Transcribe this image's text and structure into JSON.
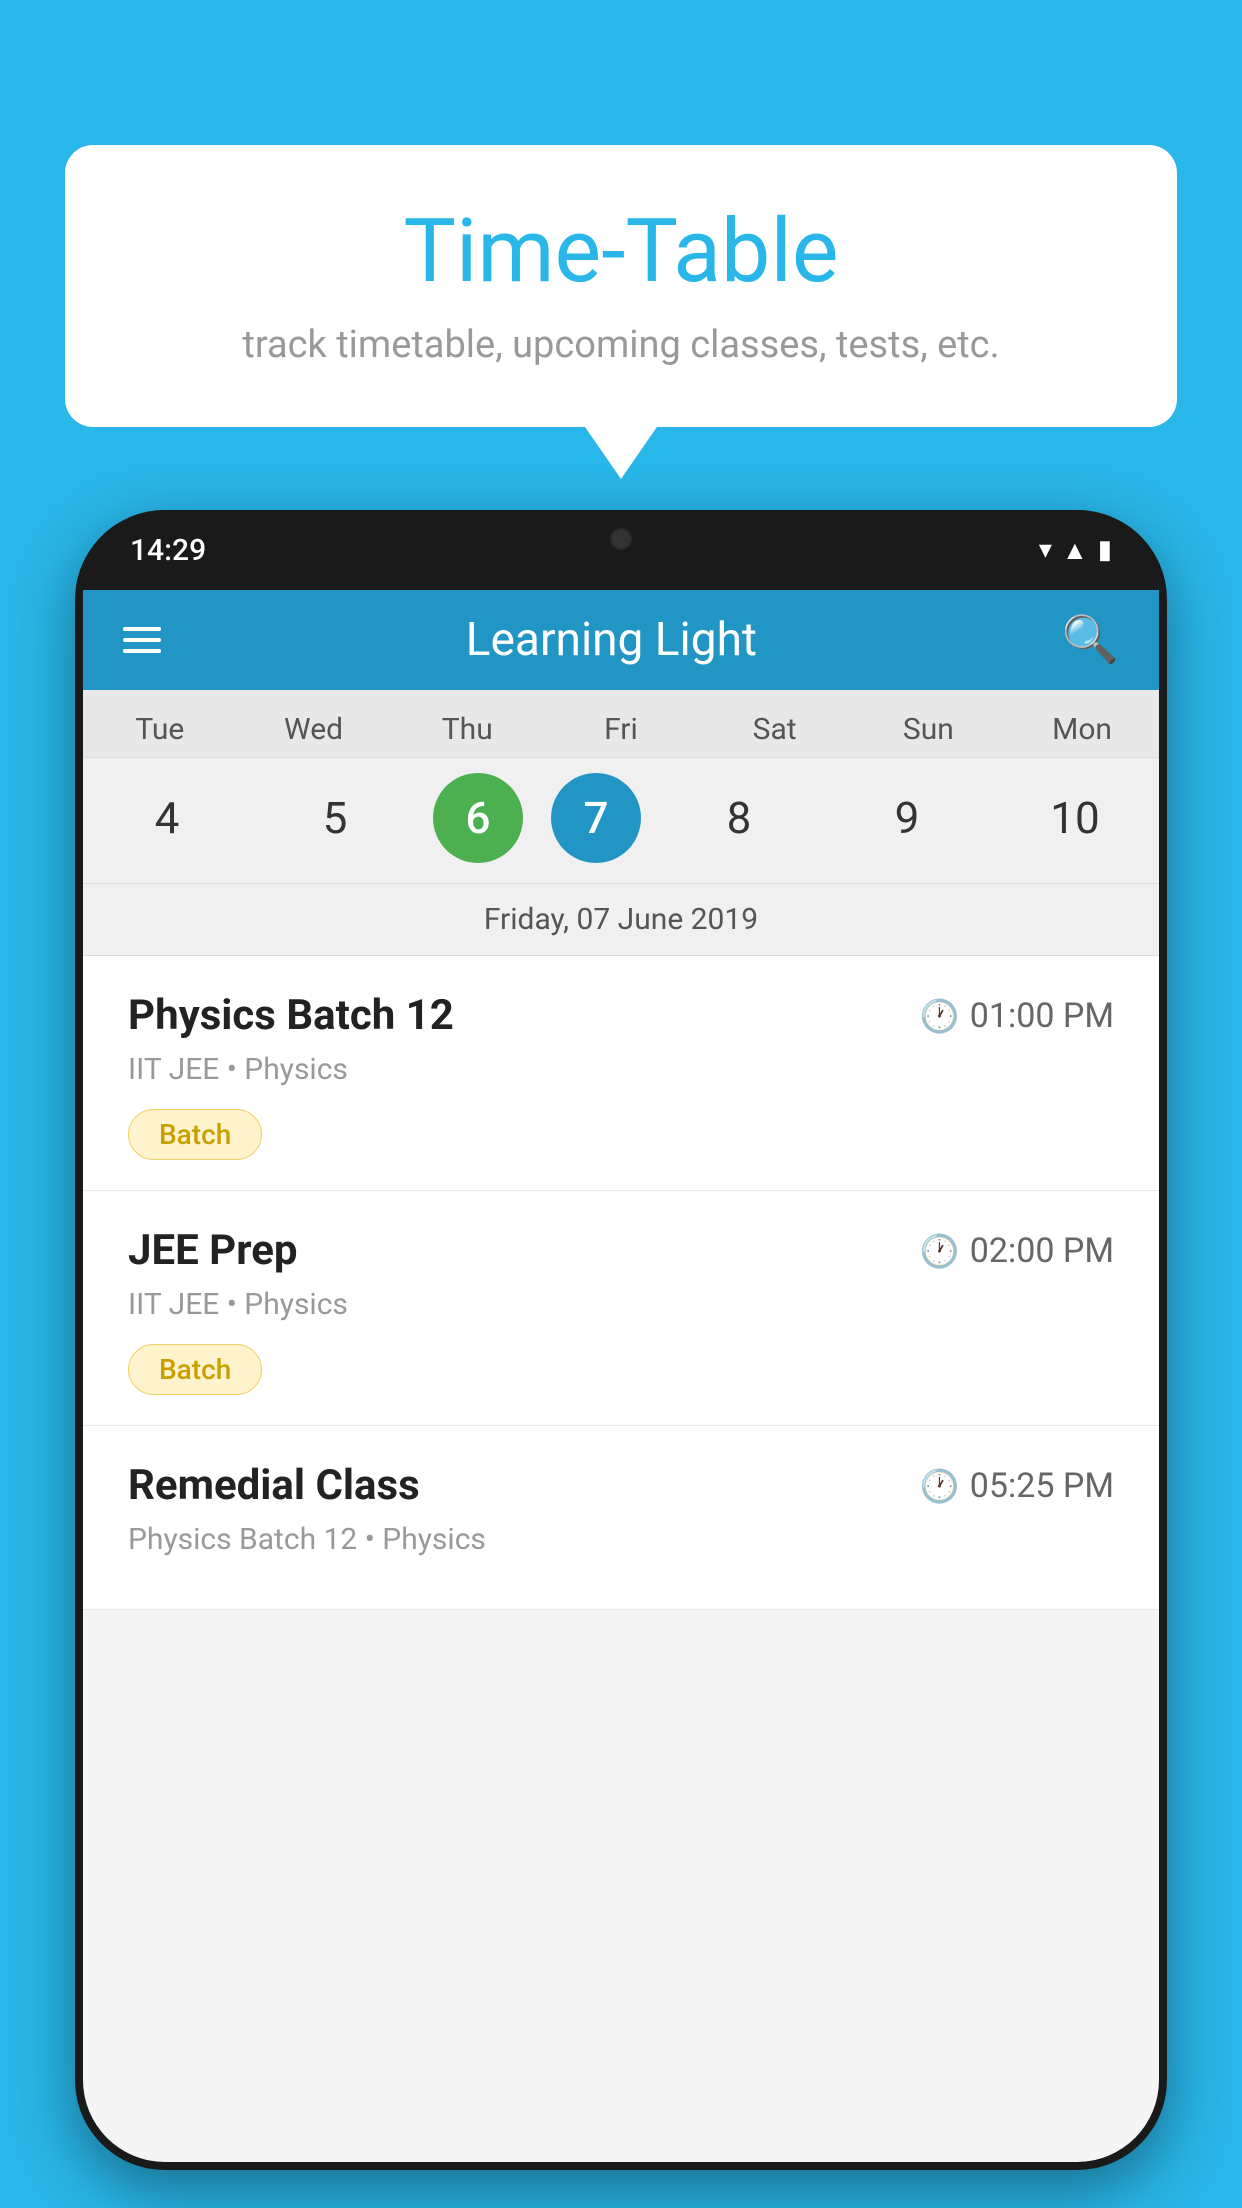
{
  "background": {
    "color": "#29B6E8"
  },
  "speech_bubble": {
    "title": "Time-Table",
    "subtitle": "track timetable, upcoming classes, tests, etc."
  },
  "phone": {
    "status_bar": {
      "time": "14:29"
    },
    "app_header": {
      "title": "Learning Light"
    },
    "calendar": {
      "days": [
        {
          "name": "Tue",
          "number": "4",
          "state": "normal"
        },
        {
          "name": "Wed",
          "number": "5",
          "state": "normal"
        },
        {
          "name": "Thu",
          "number": "6",
          "state": "today"
        },
        {
          "name": "Fri",
          "number": "7",
          "state": "selected"
        },
        {
          "name": "Sat",
          "number": "8",
          "state": "normal"
        },
        {
          "name": "Sun",
          "number": "9",
          "state": "normal"
        },
        {
          "name": "Mon",
          "number": "10",
          "state": "normal"
        }
      ],
      "selected_date_label": "Friday, 07 June 2019"
    },
    "classes": [
      {
        "name": "Physics Batch 12",
        "time": "01:00 PM",
        "details": "IIT JEE • Physics",
        "badge": "Batch"
      },
      {
        "name": "JEE Prep",
        "time": "02:00 PM",
        "details": "IIT JEE • Physics",
        "badge": "Batch"
      },
      {
        "name": "Remedial Class",
        "time": "05:25 PM",
        "details": "Physics Batch 12 • Physics",
        "badge": ""
      }
    ]
  }
}
